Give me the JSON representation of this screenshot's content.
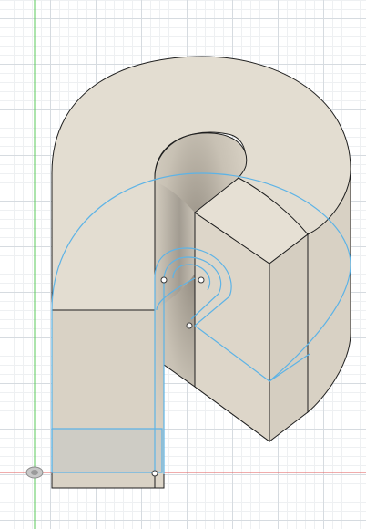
{
  "viewport": {
    "type": "cad-3d-canvas",
    "grid": true,
    "colors": {
      "background": "#ffffff",
      "grid_major": "#d6dbe0",
      "grid_minor": "#eef0f2",
      "x_axis": "#e05a5a",
      "y_axis": "#5ac85a",
      "body_face": "#e3ddd1",
      "body_side": "#ddd6c9",
      "body_shadow": "#b9b3a8",
      "edge": "#1f1f1f",
      "sketch": "#5db3e6",
      "sketch_point": "#ffffff"
    },
    "icons": [
      "origin-icon"
    ]
  }
}
